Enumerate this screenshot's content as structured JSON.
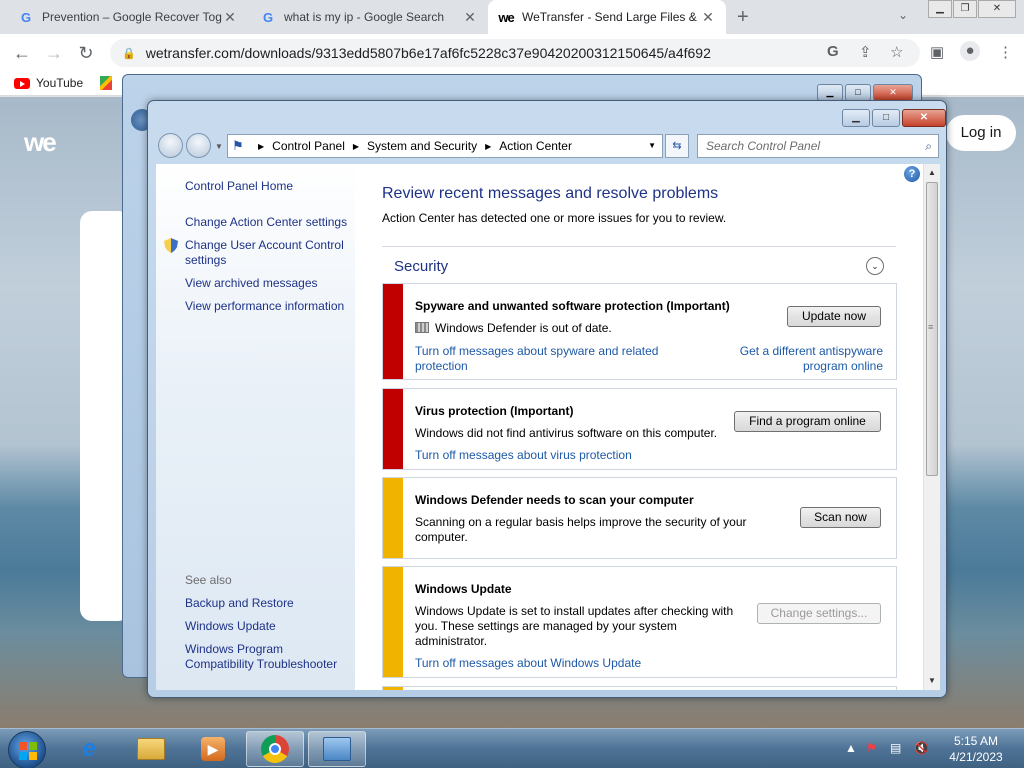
{
  "browser": {
    "tabs": [
      {
        "title": "Prevention – Google Recover Tog",
        "icon": "google-icon"
      },
      {
        "title": "what is my ip - Google Search",
        "icon": "google-icon"
      },
      {
        "title": "WeTransfer - Send Large Files &",
        "icon": "wetransfer-icon"
      }
    ],
    "new_tab": "+",
    "url": "wetransfer.com/downloads/9313edd5807b6e17af6fc5228c37e90420200312150645/a4f692",
    "bookmarks": [
      {
        "label": "YouTube"
      }
    ]
  },
  "webpage": {
    "logo": "we",
    "login_label": "Log in"
  },
  "control_panel": {
    "breadcrumb": [
      "Control Panel",
      "System and Security",
      "Action Center"
    ],
    "search_placeholder": "Search Control Panel",
    "left_links": [
      "Control Panel Home",
      "Change Action Center settings",
      "Change User Account Control settings",
      "View archived messages",
      "View performance information"
    ],
    "see_also_heading": "See also",
    "see_also_links": [
      "Backup and Restore",
      "Windows Update",
      "Windows Program Compatibility Troubleshooter"
    ],
    "main_title": "Review recent messages and resolve problems",
    "main_subtitle": "Action Center has detected one or more issues for you to review.",
    "section_title": "Security",
    "cards": [
      {
        "title": "Spyware and unwanted software protection  (Important)",
        "text": "Windows Defender is out of date.",
        "button": "Update now",
        "link_left": "Turn off messages about spyware and related protection",
        "link_right": "Get a different antispyware program online",
        "severity_color": "#c00000"
      },
      {
        "title": "Virus protection  (Important)",
        "text": "Windows did not find antivirus software on this computer.",
        "button": "Find a program online",
        "link_left": "Turn off messages about virus protection",
        "severity_color": "#c00000"
      },
      {
        "title": "Windows Defender needs to scan your computer",
        "text": "Scanning on a regular basis helps improve the security of your computer.",
        "button": "Scan now",
        "severity_color": "#f0b400"
      },
      {
        "title": "Windows Update",
        "text": "Windows Update is set to install updates after checking with you.  These settings are managed by your system administrator.",
        "button": "Change settings...",
        "link_left": "Turn off messages about Windows Update",
        "severity_color": "#f0b400"
      }
    ]
  },
  "taskbar": {
    "time": "5:15 AM",
    "date": "4/21/2023"
  }
}
